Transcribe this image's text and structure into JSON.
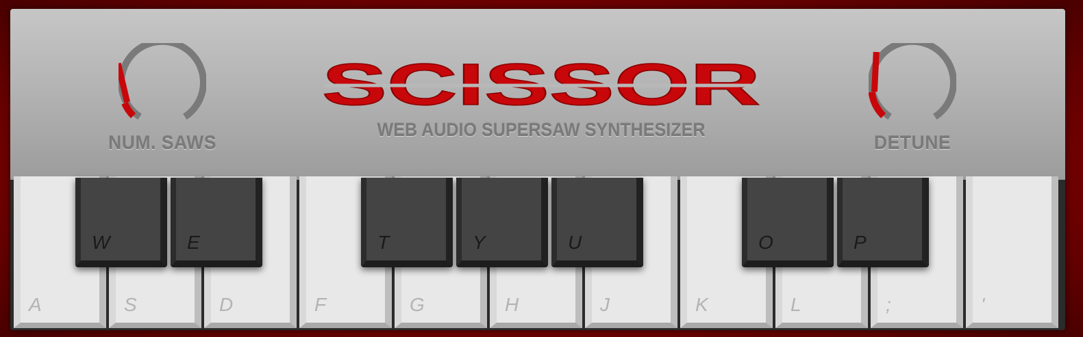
{
  "app": {
    "title": "SCISSOR",
    "subtitle": "WEB AUDIO SUPERSAW SYNTHESIZER"
  },
  "colors": {
    "background": "#8a0000",
    "panel": "#b4b4b4",
    "accent": "#c8070a",
    "knob_track": "#7a7a7a",
    "white_key": "#e8e8e8",
    "black_key": "#444444"
  },
  "knobs": [
    {
      "id": "num_saws",
      "label": "NUM. SAWS",
      "value": 0.08
    },
    {
      "id": "detune",
      "label": "DETUNE",
      "value": 0.14
    }
  ],
  "keyboard": {
    "white_keys": [
      "A",
      "S",
      "D",
      "F",
      "G",
      "H",
      "J",
      "K",
      "L",
      ";",
      "'"
    ],
    "black_keys": [
      "W",
      "E",
      "T",
      "Y",
      "U",
      "O",
      "P"
    ]
  }
}
